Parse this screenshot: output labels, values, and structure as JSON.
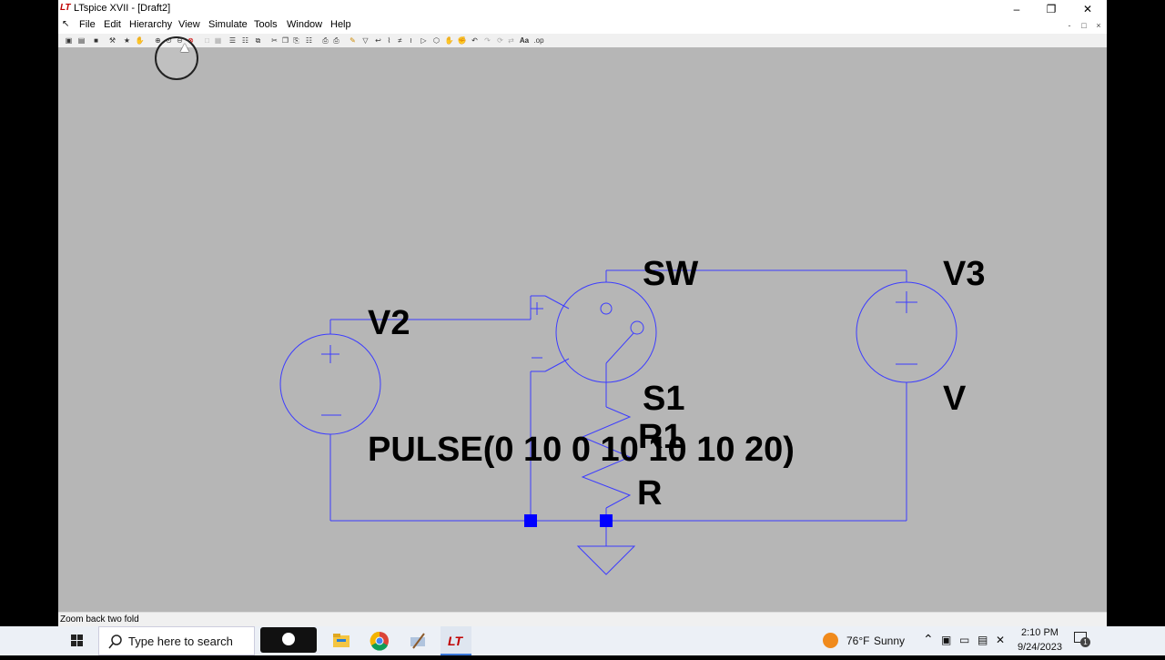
{
  "window": {
    "title": "LTspice XVII - [Draft2]",
    "minimize_glyph": "–",
    "restore_glyph": "❐",
    "close_glyph": "✕"
  },
  "menu": [
    "File",
    "Edit",
    "Hierarchy",
    "View",
    "Simulate",
    "Tools",
    "Window",
    "Help"
  ],
  "mdi_controls": [
    "-",
    "□",
    "×"
  ],
  "toolbar": {
    "text_tool_label": "Aa",
    "spice_directive_label": ".op"
  },
  "schematic": {
    "labels": {
      "v2_name": "V2",
      "v3_name": "V3",
      "v3_value": "V",
      "sw_model": "SW",
      "s1_name": "S1",
      "r1_name": "R1",
      "r1_value": "R",
      "pulse": "PULSE(0 10 0 10 10 10 20)"
    },
    "colors": {
      "background": "#b6b6b6",
      "wire": "#3c3cff",
      "component": "#3c3cff",
      "junction": "#0000ff",
      "label": "#000000"
    }
  },
  "status": {
    "text": "Zoom back two fold"
  },
  "taskbar": {
    "search_placeholder": "Type here to search",
    "weather_temp": "76°F",
    "weather_desc": "Sunny",
    "time": "2:10 PM",
    "date": "9/24/2023",
    "notification_count": "1"
  }
}
